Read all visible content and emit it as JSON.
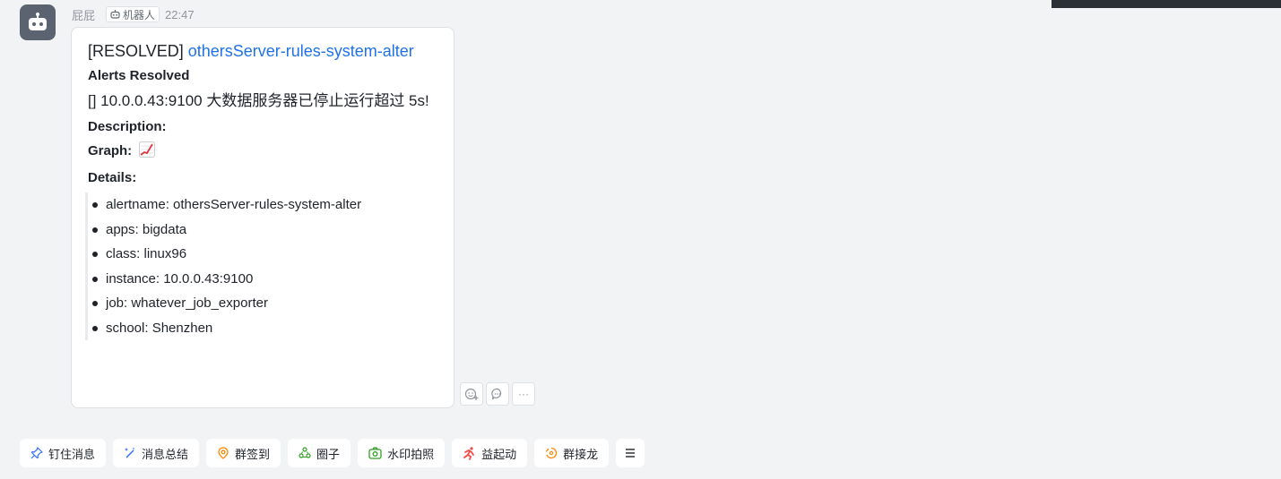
{
  "message": {
    "sender": "屁屁",
    "tag": "机器人",
    "time": "22:47",
    "title_prefix": "[RESOLVED]",
    "title_link": "othersServer-rules-system-alter",
    "alerts_heading": "Alerts Resolved",
    "alert_text": "[] 10.0.0.43:9100 大数据服务器已停止运行超过 5s!",
    "description_label": "Description:",
    "graph_label": "Graph:",
    "details_label": "Details:",
    "details": [
      "alertname: othersServer-rules-system-alter",
      "apps: bigdata",
      "class: linux96",
      "instance: 10.0.0.43:9100",
      "job: whatever_job_exporter",
      "school: Shenzhen"
    ]
  },
  "actions": {
    "more": "···"
  },
  "toolbar": {
    "pin": "钉住消息",
    "summary": "消息总结",
    "checkin": "群签到",
    "circle": "圈子",
    "watermark_photo": "水印拍照",
    "yiqidong": "益起动",
    "solitaire": "群接龙"
  },
  "colors": {
    "link": "#1f72e8",
    "background": "#f2f3f5",
    "avatar": "#5b6270"
  }
}
